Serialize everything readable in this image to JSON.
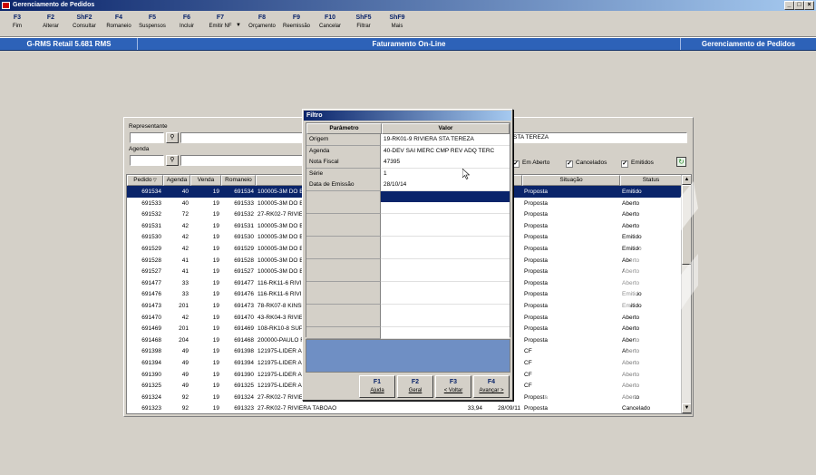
{
  "window": {
    "title": "Gerenciamento de Pedidos",
    "controls": [
      "_",
      "□",
      "×"
    ]
  },
  "toolbar": {
    "keys": [
      {
        "key": "F3",
        "label": "Fim"
      },
      {
        "key": "F2",
        "label": "Alterar"
      },
      {
        "key": "ShF2",
        "label": "Consultar"
      },
      {
        "key": "F4",
        "label": "Romaneio"
      },
      {
        "key": "F5",
        "label": "Suspensos"
      },
      {
        "key": "F6",
        "label": "Incluir"
      },
      {
        "key": "F7",
        "label": "Emitir NF"
      },
      {
        "key": "F8",
        "label": "Orçamento"
      },
      {
        "key": "F9",
        "label": "Reemissão"
      },
      {
        "key": "F10",
        "label": "Cancelar"
      },
      {
        "key": "ShF5",
        "label": "Filtrar"
      },
      {
        "key": "ShF9",
        "label": "Mais"
      }
    ]
  },
  "header": {
    "left": "G-RMS Retail 5.681 RMS",
    "center": "Faturamento On-Line",
    "right": "Gerenciamento de Pedidos"
  },
  "panel": {
    "representante_label": "Representante",
    "agenda_label": "Agenda",
    "visible_field_text": "STA TEREZA",
    "checkboxes": [
      {
        "label": "Em Aberto",
        "checked": true
      },
      {
        "label": "Cancelados",
        "checked": true
      },
      {
        "label": "Emitidos",
        "checked": true
      }
    ],
    "columns": [
      "Pedido",
      "Agenda",
      "Venda",
      "Romaneio",
      "",
      "",
      "",
      "Situação",
      "Status"
    ],
    "rows": [
      {
        "pedido": "691534",
        "agenda": "40",
        "venda": "19",
        "romaneio": "691534",
        "cliente": "100005-3M DO BI",
        "valor": "",
        "data": "",
        "situacao": "Proposta",
        "status": "Emitido",
        "selected": true
      },
      {
        "pedido": "691533",
        "agenda": "40",
        "venda": "19",
        "romaneio": "691533",
        "cliente": "100005-3M DO BI",
        "valor": "",
        "data": "",
        "situacao": "Proposta",
        "status": "Aberto"
      },
      {
        "pedido": "691532",
        "agenda": "72",
        "venda": "19",
        "romaneio": "691532",
        "cliente": "27-RK02-7 RIVIEF",
        "valor": "",
        "data": "",
        "situacao": "Proposta",
        "status": "Aberto"
      },
      {
        "pedido": "691531",
        "agenda": "42",
        "venda": "19",
        "romaneio": "691531",
        "cliente": "100005-3M DO BI",
        "valor": "",
        "data": "",
        "situacao": "Proposta",
        "status": "Aberto"
      },
      {
        "pedido": "691530",
        "agenda": "42",
        "venda": "19",
        "romaneio": "691530",
        "cliente": "100005-3M DO BI",
        "valor": "",
        "data": "",
        "situacao": "Proposta",
        "status": "Emitido"
      },
      {
        "pedido": "691529",
        "agenda": "42",
        "venda": "19",
        "romaneio": "691529",
        "cliente": "100005-3M DO BI",
        "valor": "",
        "data": "",
        "situacao": "Proposta",
        "status": "Emitido"
      },
      {
        "pedido": "691528",
        "agenda": "41",
        "venda": "19",
        "romaneio": "691528",
        "cliente": "100005-3M DO BI",
        "valor": "",
        "data": "",
        "situacao": "Proposta",
        "status": "Aberto"
      },
      {
        "pedido": "691527",
        "agenda": "41",
        "venda": "19",
        "romaneio": "691527",
        "cliente": "100005-3M DO BI",
        "valor": "",
        "data": "",
        "situacao": "Proposta",
        "status": "Aberto"
      },
      {
        "pedido": "691477",
        "agenda": "33",
        "venda": "19",
        "romaneio": "691477",
        "cliente": "116-RK11-6 RIVIE",
        "valor": "",
        "data": "",
        "situacao": "Proposta",
        "status": "Aberto"
      },
      {
        "pedido": "691476",
        "agenda": "33",
        "venda": "19",
        "romaneio": "691476",
        "cliente": "116-RK11-6 RIVIE",
        "valor": "",
        "data": "",
        "situacao": "Proposta",
        "status": "Emitido"
      },
      {
        "pedido": "691473",
        "agenda": "201",
        "venda": "19",
        "romaneio": "691473",
        "cliente": "78-RK07-8 KINSH",
        "valor": "",
        "data": "",
        "situacao": "Proposta",
        "status": "Emitido"
      },
      {
        "pedido": "691470",
        "agenda": "42",
        "venda": "19",
        "romaneio": "691470",
        "cliente": "43-RK04-3 RIVIEF",
        "valor": "",
        "data": "",
        "situacao": "Proposta",
        "status": "Aberto"
      },
      {
        "pedido": "691469",
        "agenda": "201",
        "venda": "19",
        "romaneio": "691469",
        "cliente": "108-RK10-8 SUPE",
        "valor": "",
        "data": "",
        "situacao": "Proposta",
        "status": "Aberto"
      },
      {
        "pedido": "691468",
        "agenda": "204",
        "venda": "19",
        "romaneio": "691468",
        "cliente": "200000-PAULO F",
        "valor": "",
        "data": "",
        "situacao": "Proposta",
        "status": "Aberto"
      },
      {
        "pedido": "691398",
        "agenda": "49",
        "venda": "19",
        "romaneio": "691398",
        "cliente": "121975-LIDER AL",
        "valor": "",
        "data": "",
        "situacao": "CF",
        "status": "Aberto"
      },
      {
        "pedido": "691394",
        "agenda": "49",
        "venda": "19",
        "romaneio": "691394",
        "cliente": "121975-LIDER AL",
        "valor": "",
        "data": "",
        "situacao": "CF",
        "status": "Aberto"
      },
      {
        "pedido": "691390",
        "agenda": "49",
        "venda": "19",
        "romaneio": "691390",
        "cliente": "121975-LIDER AL",
        "valor": "",
        "data": "",
        "situacao": "CF",
        "status": "Aberto"
      },
      {
        "pedido": "691325",
        "agenda": "49",
        "venda": "19",
        "romaneio": "691325",
        "cliente": "121975-LIDER AL",
        "valor": "",
        "data": "",
        "situacao": "CF",
        "status": "Aberto"
      },
      {
        "pedido": "691324",
        "agenda": "92",
        "venda": "19",
        "romaneio": "691324",
        "cliente": "27-RK02-7 RIVIEF",
        "valor": "",
        "data": "",
        "situacao": "Proposta",
        "status": "Aberto"
      },
      {
        "pedido": "691323",
        "agenda": "92",
        "venda": "19",
        "romaneio": "691323",
        "cliente": "27-RK02-7 RIVIERA TABOAO",
        "valor": "33,94",
        "data": "28/09/11",
        "situacao": "Proposta",
        "status": "Cancelado"
      }
    ]
  },
  "dialog": {
    "title": "Filtro",
    "col_param": "Parâmetro",
    "col_valor": "Valor",
    "rows": [
      {
        "param": "Origem",
        "valor": "19-RK01-9 RIVIERA STA TEREZA"
      },
      {
        "param": "Agenda",
        "valor": "40-DEV SAI MERC CMP REV ADQ TERC"
      },
      {
        "param": "Nota Fiscal",
        "valor": "47395"
      },
      {
        "param": "Série",
        "valor": "1"
      },
      {
        "param": "Data de Emissão",
        "valor": "28/10/14"
      },
      {
        "param": "",
        "valor": "",
        "active": true
      },
      {
        "param": "",
        "valor": ""
      },
      {
        "param": "",
        "valor": ""
      },
      {
        "param": "",
        "valor": ""
      },
      {
        "param": "",
        "valor": ""
      },
      {
        "param": "",
        "valor": ""
      },
      {
        "param": "",
        "valor": ""
      },
      {
        "param": "",
        "valor": ""
      },
      {
        "param": "",
        "valor": ""
      },
      {
        "param": "",
        "valor": ""
      },
      {
        "param": "",
        "valor": ""
      },
      {
        "param": "",
        "valor": ""
      },
      {
        "param": "",
        "valor": ""
      }
    ],
    "buttons": [
      {
        "key": "F1",
        "label": "Ajuda"
      },
      {
        "key": "F2",
        "label": "Geral"
      },
      {
        "key": "F3",
        "label": "< Voltar"
      },
      {
        "key": "F4",
        "label": "Avançar >"
      }
    ]
  },
  "colors": {
    "selection": "#0a246a",
    "header_bar": "#2d62b8",
    "info_box": "#6f8fc4"
  }
}
